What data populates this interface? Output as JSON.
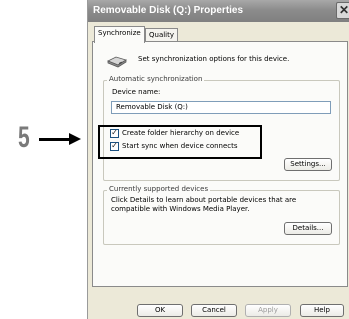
{
  "callout": {
    "step": "5"
  },
  "window": {
    "title": "Removable Disk (Q:) Properties",
    "close_glyph": "✕"
  },
  "tabs": [
    {
      "label": "Synchronize",
      "active": true
    },
    {
      "label": "Quality",
      "active": false
    }
  ],
  "header": {
    "icon": "removable-disk-icon",
    "text": "Set synchronization options for this device."
  },
  "auto_sync": {
    "group_label": "Automatic synchronization",
    "device_name_label": "Device name:",
    "device_name_value": "Removable Disk (Q:)",
    "options": [
      {
        "label": "Create folder hierarchy on device",
        "checked": true
      },
      {
        "label": "Start sync when device connects",
        "checked": true
      }
    ],
    "settings_button": "Settings..."
  },
  "supported": {
    "group_label": "Currently supported devices",
    "description": "Click Details to learn about portable devices that are compatible with Windows Media Player.",
    "details_button": "Details..."
  },
  "footer": {
    "ok": "OK",
    "cancel": "Cancel",
    "apply": "Apply",
    "help": "Help"
  },
  "colors": {
    "titlebar": "#8c8c8c",
    "dialog_bg": "#ece9d8",
    "textbox_border": "#7f9db9"
  }
}
